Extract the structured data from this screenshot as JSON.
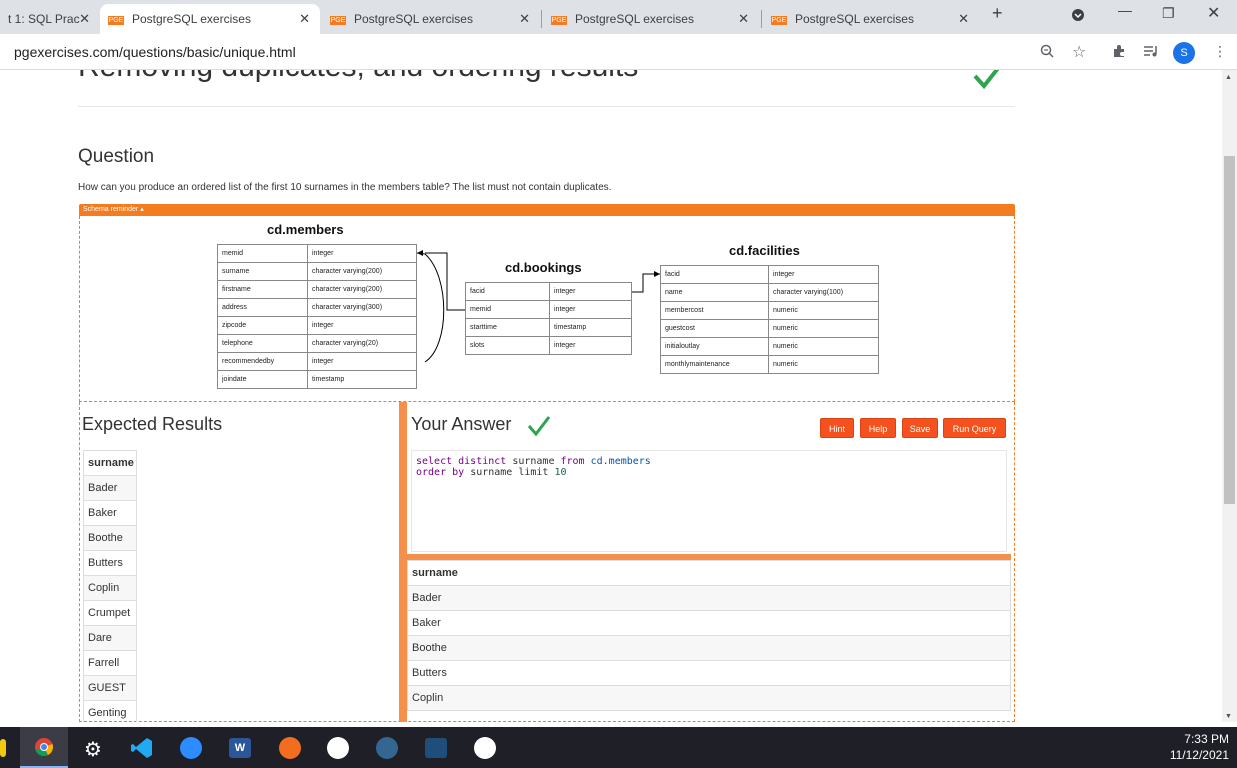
{
  "browser": {
    "tabs": [
      {
        "title": "t 1: SQL Prac",
        "favicon": ""
      },
      {
        "title": "PostgreSQL exercises",
        "favicon": "PGE"
      },
      {
        "title": "PostgreSQL exercises",
        "favicon": "PGE"
      },
      {
        "title": "PostgreSQL exercises",
        "favicon": "PGE"
      },
      {
        "title": "PostgreSQL exercises",
        "favicon": "PGE"
      }
    ],
    "url": "pgexercises.com/questions/basic/unique.html",
    "profile_initial": "S"
  },
  "page": {
    "heading": "Removing duplicates, and ordering results",
    "question_title": "Question",
    "question_text": "How can you produce an ordered list of the first 10 surnames in the members table? The list must not contain duplicates.",
    "schema_toggle": "Schema reminder ▴",
    "accent_color": "#f47b20"
  },
  "schema": {
    "members": {
      "name": "cd.members",
      "rows": [
        [
          "memid",
          "integer"
        ],
        [
          "surname",
          "character varying(200)"
        ],
        [
          "firstname",
          "character varying(200)"
        ],
        [
          "address",
          "character varying(300)"
        ],
        [
          "zipcode",
          "integer"
        ],
        [
          "telephone",
          "character varying(20)"
        ],
        [
          "recommendedby",
          "integer"
        ],
        [
          "joindate",
          "timestamp"
        ]
      ]
    },
    "bookings": {
      "name": "cd.bookings",
      "rows": [
        [
          "facid",
          "integer"
        ],
        [
          "memid",
          "integer"
        ],
        [
          "starttime",
          "timestamp"
        ],
        [
          "slots",
          "integer"
        ]
      ]
    },
    "facilities": {
      "name": "cd.facilities",
      "rows": [
        [
          "facid",
          "integer"
        ],
        [
          "name",
          "character varying(100)"
        ],
        [
          "membercost",
          "numeric"
        ],
        [
          "guestcost",
          "numeric"
        ],
        [
          "initialoutlay",
          "numeric"
        ],
        [
          "monthlymaintenance",
          "numeric"
        ]
      ]
    }
  },
  "expected": {
    "title": "Expected Results",
    "header": "surname",
    "rows": [
      "Bader",
      "Baker",
      "Boothe",
      "Butters",
      "Coplin",
      "Crumpet",
      "Dare",
      "Farrell",
      "GUEST",
      "Genting"
    ]
  },
  "answer": {
    "title": "Your Answer",
    "buttons": {
      "hint": "Hint",
      "help": "Help",
      "save": "Save",
      "run": "Run Query"
    },
    "sql_line1": [
      [
        "kw",
        "select distinct "
      ],
      [
        "tx",
        "surname "
      ],
      [
        "kw",
        "from "
      ],
      [
        "id",
        "cd.members"
      ]
    ],
    "sql_line2": [
      [
        "kw",
        "order by "
      ],
      [
        "tx",
        "surname limit "
      ],
      [
        "num",
        "10"
      ]
    ],
    "result_header": "surname",
    "result_rows": [
      "Bader",
      "Baker",
      "Boothe",
      "Butters",
      "Coplin"
    ]
  },
  "taskbar": {
    "time": "7:33 PM",
    "date": "11/12/2021"
  }
}
